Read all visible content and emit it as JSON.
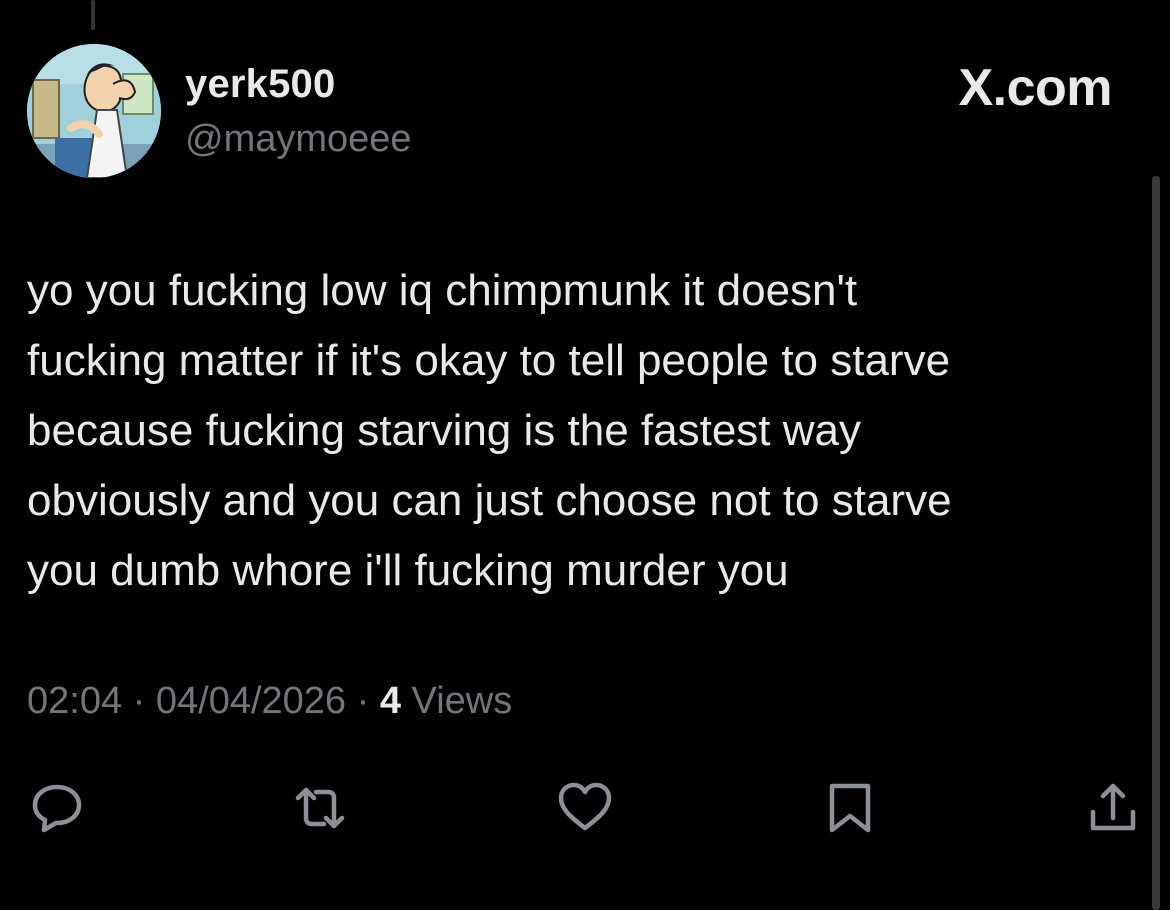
{
  "header": {
    "display_name": "yerk500",
    "handle": "@maymoeee",
    "brand": "X.com"
  },
  "avatar": {
    "description_icon": "cartoon-avatar"
  },
  "tweet": {
    "lines": [
      "yo you fucking low iq chimpmunk it doesn't",
      "fucking matter if it's okay to tell people to starve",
      "because fucking starving is the fastest way",
      "obviously and you can just choose not to starve",
      "you dumb whore i'll fucking murder you"
    ]
  },
  "meta": {
    "time": "02:04",
    "separator": " · ",
    "date": "04/04/2026",
    "views_count": "4",
    "views_label": " Views"
  },
  "actions": {
    "icons": [
      "reply-icon",
      "retweet-icon",
      "like-icon",
      "bookmark-icon",
      "share-icon"
    ]
  },
  "colors": {
    "background": "#000000",
    "text_primary": "#e7e9ea",
    "text_secondary": "#71767b"
  }
}
